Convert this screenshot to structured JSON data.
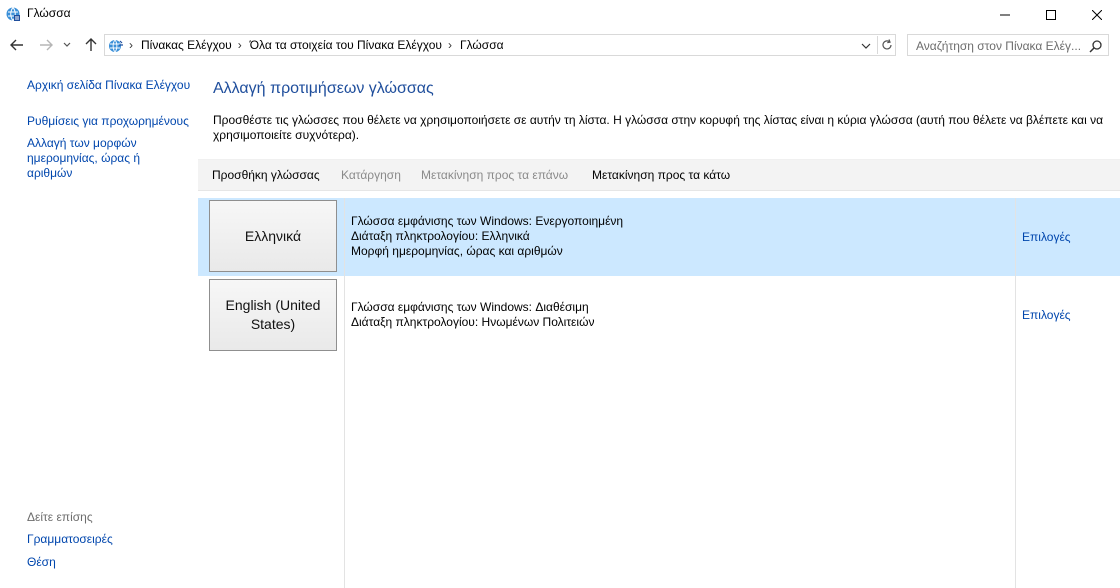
{
  "window": {
    "title": "Γλώσσα",
    "icon": "language-globe-icon"
  },
  "navigation": {
    "breadcrumbs": [
      "Πίνακας Ελέγχου",
      "Όλα τα στοιχεία του Πίνακα Ελέγχου",
      "Γλώσσα"
    ],
    "separator": "›",
    "search_placeholder": "Αναζήτηση στον Πίνακα Ελέγ..."
  },
  "sidebar": {
    "home_link": "Αρχική σελίδα Πίνακα Ελέγχου",
    "links": [
      "Ρυθμίσεις για προχωρημένους",
      "Αλλαγή των μορφών ημερομηνίας, ώρας ή αριθμών"
    ],
    "see_also_label": "Δείτε επίσης",
    "see_also": [
      "Γραμματοσειρές",
      "Θέση"
    ]
  },
  "main": {
    "title": "Αλλαγή προτιμήσεων γλώσσας",
    "description": "Προσθέστε τις γλώσσες που θέλετε να χρησιμοποιήσετε σε αυτήν τη λίστα. Η γλώσσα στην κορυφή της λίστας είναι η κύρια γλώσσα (αυτή που θέλετε να βλέπετε και να χρησιμοποιείτε συχνότερα).",
    "toolbar": {
      "add": "Προσθήκη γλώσσας",
      "remove": "Κατάργηση",
      "move_up": "Μετακίνηση προς τα επάνω",
      "move_down": "Μετακίνηση προς τα κάτω"
    },
    "languages": [
      {
        "name": "Ελληνικά",
        "details": [
          "Γλώσσα εμφάνισης των Windows: Ενεργοποιημένη",
          "Διάταξη πληκτρολογίου: Ελληνικά",
          "Μορφή ημερομηνίας, ώρας και αριθμών"
        ],
        "options": "Επιλογές",
        "selected": true
      },
      {
        "name": "English (United States)",
        "details": [
          "Γλώσσα εμφάνισης των Windows: Διαθέσιμη",
          "Διάταξη πληκτρολογίου: Ηνωμένων Πολιτειών"
        ],
        "options": "Επιλογές",
        "selected": false
      }
    ]
  },
  "colors": {
    "link": "#0046ad",
    "selected_row": "#cce8ff",
    "toolbar_bg": "#f3f3f3",
    "disabled_text": "#8a8a8a"
  }
}
